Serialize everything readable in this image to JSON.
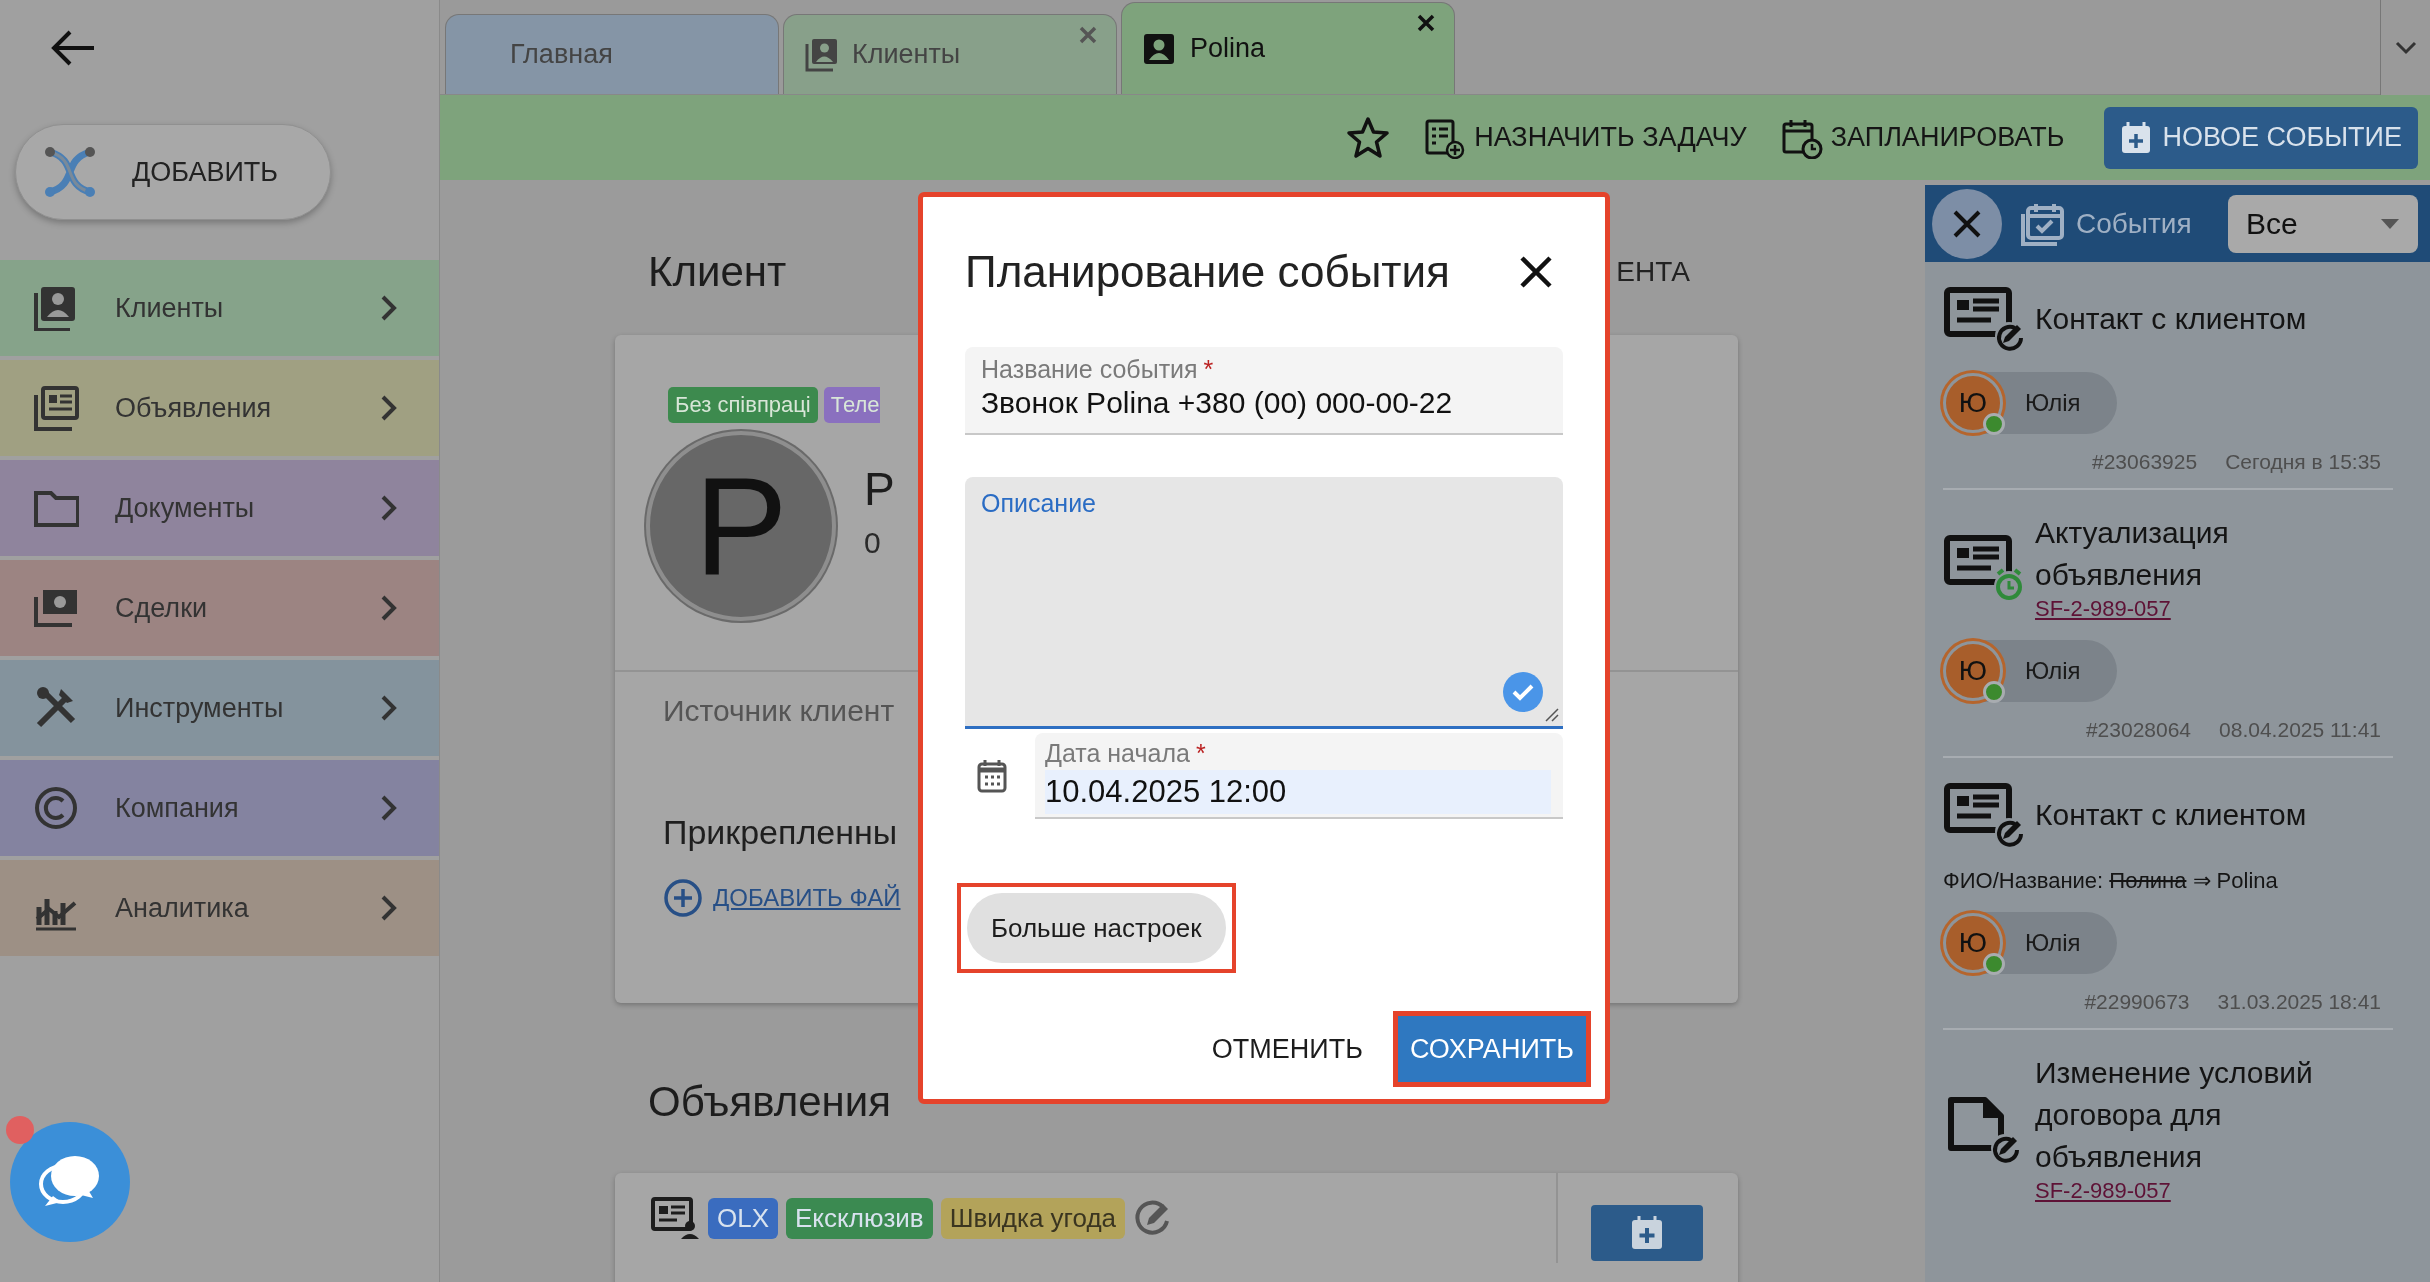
{
  "sidebar": {
    "add_button": "ДОБАВИТЬ",
    "items": [
      {
        "label": "Клиенты",
        "color": "#86a38a",
        "kind": "clients"
      },
      {
        "label": "Объявления",
        "color": "#a0a082",
        "kind": "listings"
      },
      {
        "label": "Документы",
        "color": "#8f849d",
        "kind": "documents"
      },
      {
        "label": "Сделки",
        "color": "#9c8482",
        "kind": "deals"
      },
      {
        "label": "Инструменты",
        "color": "#84939d",
        "kind": "tools"
      },
      {
        "label": "Компания",
        "color": "#8483a0",
        "kind": "company"
      },
      {
        "label": "Аналитика",
        "color": "#9d9085",
        "kind": "analytics"
      }
    ]
  },
  "tabs": [
    {
      "label": "Главная",
      "selected": false,
      "color": "#8595a6",
      "icon": false,
      "closable": false
    },
    {
      "label": "Клиенты",
      "selected": false,
      "color": "#88a08a",
      "icon": true,
      "closable": true
    },
    {
      "label": "Polina",
      "selected": true,
      "color": "#7ea37c",
      "icon": true,
      "closable": true
    }
  ],
  "toolbar": {
    "actions": [
      {
        "kind": "task",
        "label": "НАЗНАЧИТЬ ЗАДАЧУ"
      },
      {
        "kind": "schedule",
        "label": "ЗАПЛАНИРОВАТЬ"
      }
    ],
    "primary": "НОВОЕ СОБЫТИЕ"
  },
  "client": {
    "heading": "Клиент",
    "heading_action": "ЕНТА",
    "tags": [
      {
        "label": "Без співпраці",
        "color": "#3d8a4e"
      },
      {
        "label": "Теле",
        "color": "#8a70bf"
      }
    ],
    "avatar_letter": "P",
    "name": "P",
    "phone": "0",
    "source_label": "Источник клиент",
    "attachments_heading": "Прикрепленны",
    "add_file": "ДОБАВИТЬ ФАЙ"
  },
  "listings": {
    "heading": "Объявления",
    "tags": [
      {
        "label": "OLX",
        "color": "#3a6cbf"
      },
      {
        "label": "Ексклюзив",
        "color": "#3b8a51"
      },
      {
        "label": "Швидка угода",
        "color": "#b3a35a"
      }
    ]
  },
  "events_panel": {
    "title": "События",
    "filter": "Все",
    "events": [
      {
        "kind": "contact",
        "title": "Контакт с клиентом",
        "user": {
          "initial": "Ю",
          "name": "Юлія",
          "online": true
        },
        "id": "#23063925",
        "time": "Сегодня в 15:35"
      },
      {
        "kind": "update",
        "title": "Актуализация объявления",
        "link": "SF-2-989-057",
        "user": {
          "initial": "Ю",
          "name": "Юлія",
          "online": true
        },
        "id": "#23028064",
        "time": "08.04.2025 11:41"
      },
      {
        "kind": "contact",
        "title": "Контакт с клиентом",
        "change": {
          "label": "ФИО/Название:",
          "old": "Полина",
          "arrow": "⇒",
          "new": "Polina"
        },
        "user": {
          "initial": "Ю",
          "name": "Юлія",
          "online": true
        },
        "id": "#22990673",
        "time": "31.03.2025 18:41"
      },
      {
        "kind": "contract",
        "title": "Изменение условий договора для объявления",
        "link": "SF-2-989-057"
      }
    ]
  },
  "dialog": {
    "title": "Планирование события",
    "highlighted": true,
    "fields": [
      {
        "kind": "text",
        "label": "Название события",
        "required_mark": "*",
        "value": "Звонок Polina +380 (00) 000-00-22",
        "focused": false
      },
      {
        "kind": "textarea",
        "label": "Описание",
        "focused": true
      },
      {
        "kind": "datetime",
        "label": "Дата начала",
        "required_mark": "*",
        "value": "10.04.2025 12:00",
        "focused": false
      }
    ],
    "more_button": {
      "label": "Больше настроек",
      "highlighted": true
    },
    "cancel": "ОТМЕНИТЬ",
    "save": {
      "label": "СОХРАНИТЬ",
      "highlighted": true
    }
  },
  "chat": {
    "unread": true
  }
}
